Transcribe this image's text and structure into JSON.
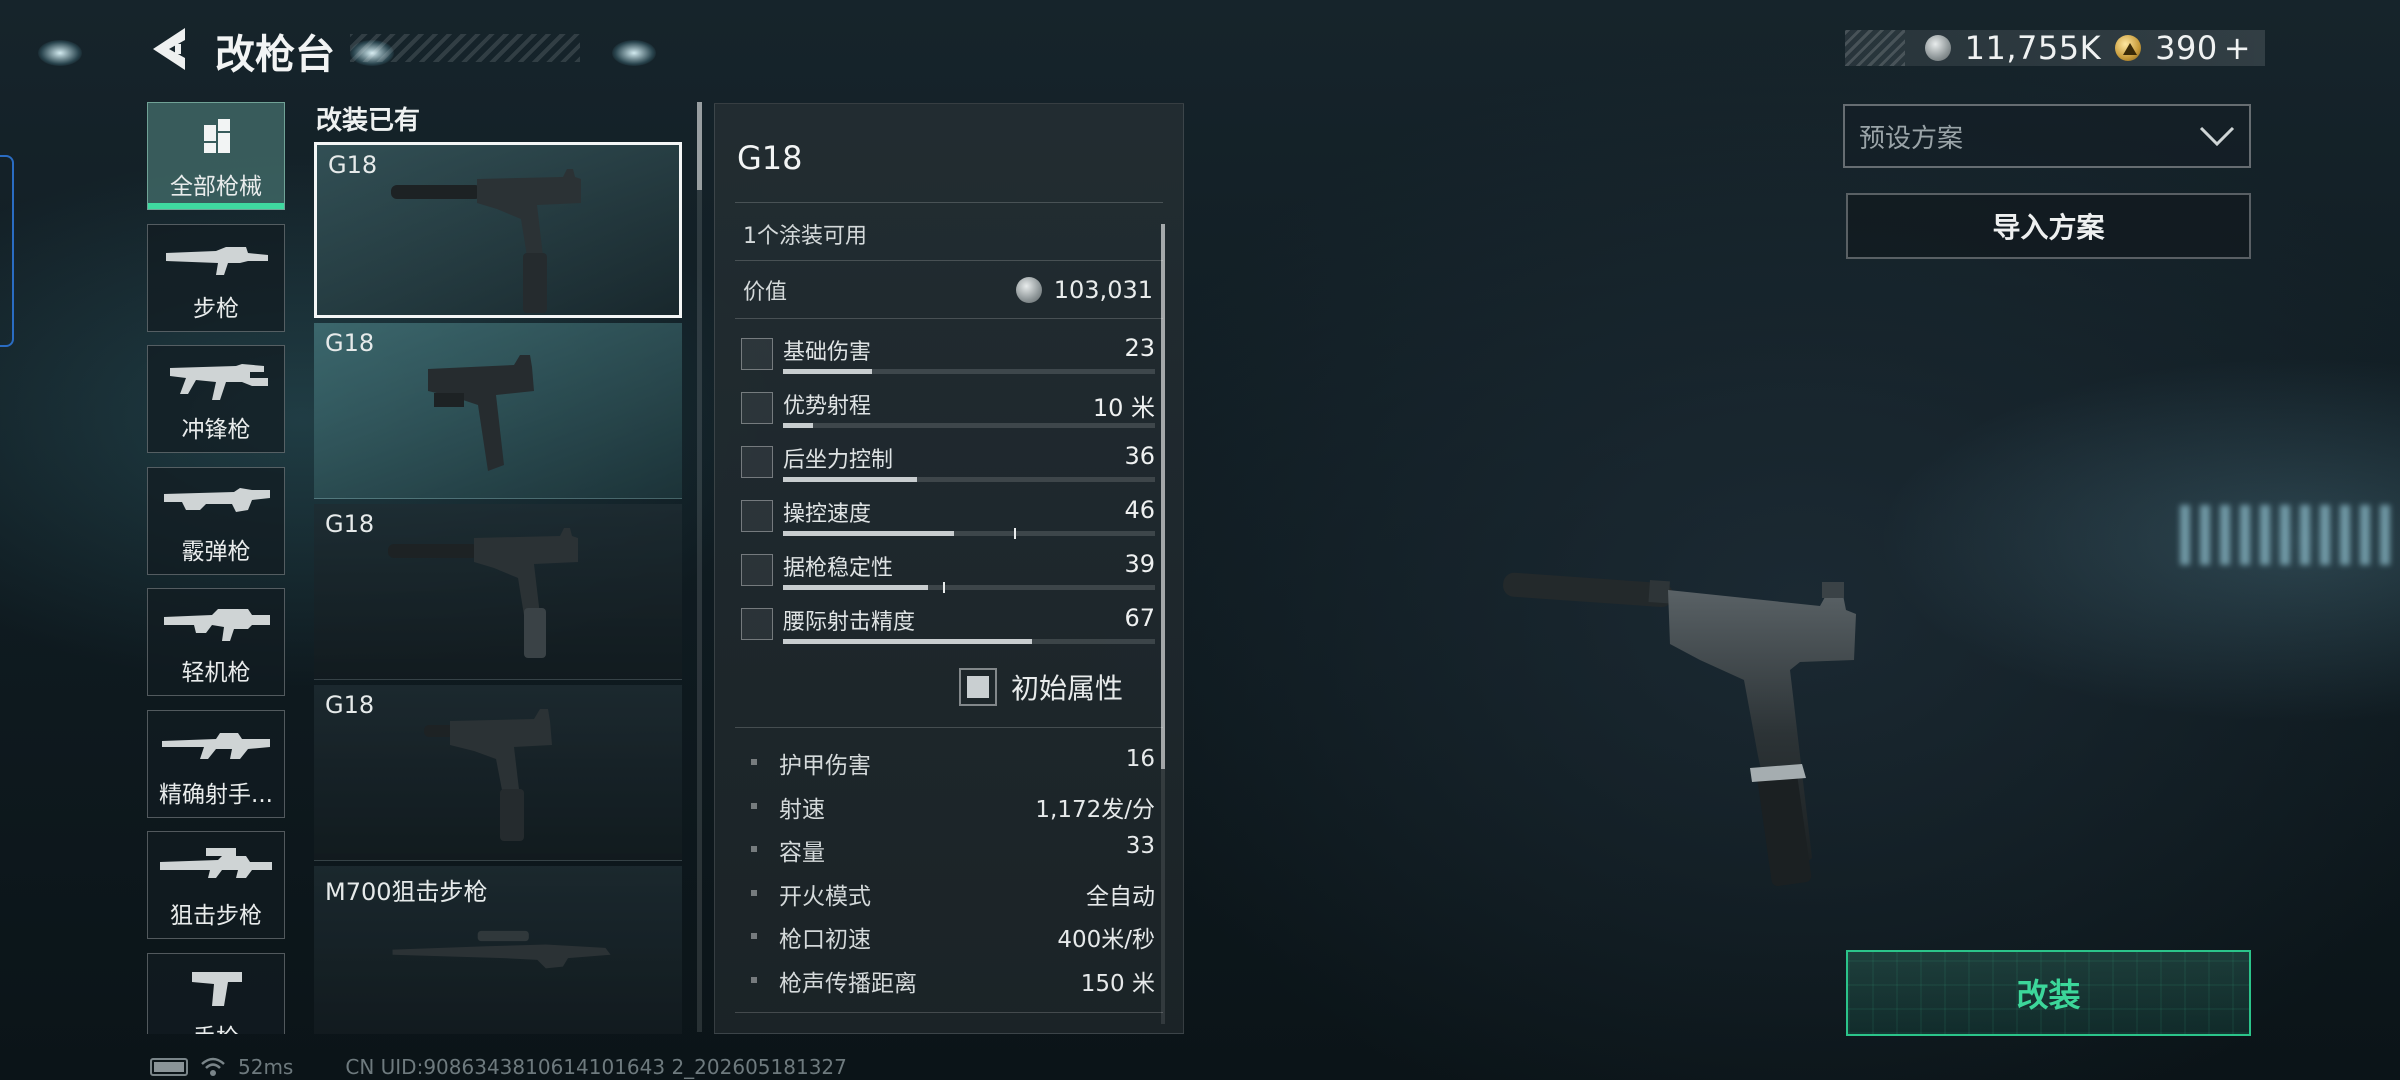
{
  "header": {
    "title": "改枪台"
  },
  "currency": {
    "silver": "11,755K",
    "gold": "390",
    "gold_plus": "+"
  },
  "preset": {
    "placeholder": "预设方案",
    "import_label": "导入方案"
  },
  "action": {
    "modify_label": "改装"
  },
  "categories": [
    {
      "label": "全部枪械",
      "icon": "grid-icon",
      "active": true
    },
    {
      "label": "步枪",
      "icon": "rifle-icon"
    },
    {
      "label": "冲锋枪",
      "icon": "smg-icon"
    },
    {
      "label": "霰弹枪",
      "icon": "shotgun-icon"
    },
    {
      "label": "轻机枪",
      "icon": "lmg-icon"
    },
    {
      "label": "精确射手...",
      "icon": "marksman-rifle-icon"
    },
    {
      "label": "狙击步枪",
      "icon": "sniper-rifle-icon"
    },
    {
      "label": "手枪",
      "icon": "pistol-icon"
    }
  ],
  "owned": {
    "header": "改装已有",
    "weapons": [
      {
        "name": "G18",
        "selected": true
      },
      {
        "name": "G18"
      },
      {
        "name": "G18"
      },
      {
        "name": "G18"
      },
      {
        "name": "M700狙击步枪"
      }
    ]
  },
  "details": {
    "name": "G18",
    "skins_available": "1个涂装可用",
    "value_label": "价值",
    "value": "103,031",
    "stats": [
      {
        "label": "基础伤害",
        "value": "23",
        "fill": 0.24,
        "icon": "damage-icon"
      },
      {
        "label": "优势射程",
        "value": "10 米",
        "fill": 0.08,
        "icon": "range-icon"
      },
      {
        "label": "后坐力控制",
        "value": "36",
        "fill": 0.36,
        "icon": "recoil-icon"
      },
      {
        "label": "操控速度",
        "value": "46",
        "fill": 0.46,
        "tick": 0.62,
        "icon": "handling-icon"
      },
      {
        "label": "据枪稳定性",
        "value": "39",
        "fill": 0.39,
        "tick": 0.43,
        "icon": "stability-icon"
      },
      {
        "label": "腰际射击精度",
        "value": "67",
        "fill": 0.67,
        "icon": "hipfire-icon"
      }
    ],
    "base_attr_label": "初始属性",
    "extra": [
      {
        "label": "护甲伤害",
        "value": "16"
      },
      {
        "label": "射速",
        "value": "1,172发/分"
      },
      {
        "label": "容量",
        "value": "33"
      },
      {
        "label": "开火模式",
        "value": "全自动"
      },
      {
        "label": "枪口初速",
        "value": "400米/秒"
      },
      {
        "label": "枪声传播距离",
        "value": "150 米"
      }
    ]
  },
  "footer": {
    "ping": "52ms",
    "uid": "CN UID:9086343810614101643 2_202605181327"
  }
}
